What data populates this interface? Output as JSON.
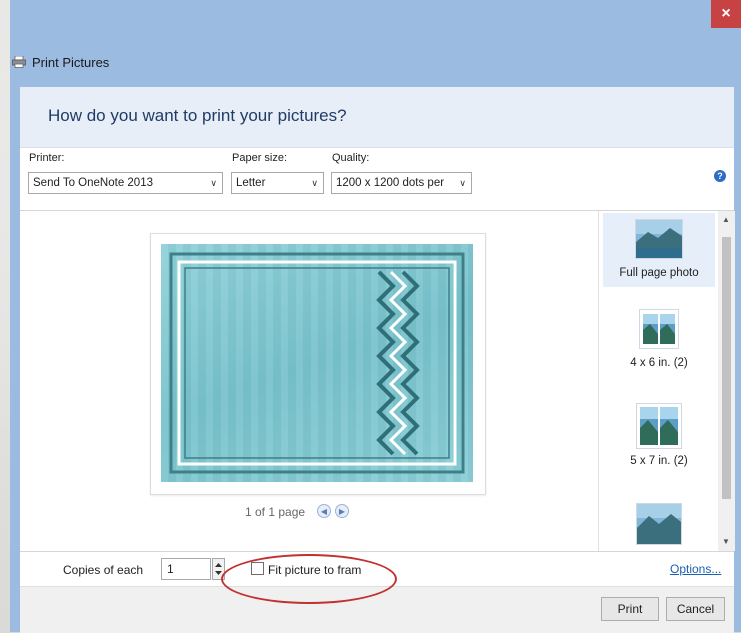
{
  "window": {
    "title": "Print Pictures",
    "close_icon": "×"
  },
  "heading": "How do you want to print your pictures?",
  "toolbar": {
    "printer_label": "Printer:",
    "printer_value": "Send To OneNote 2013",
    "paper_label": "Paper size:",
    "paper_value": "Letter",
    "quality_label": "Quality:",
    "quality_value": "1200 x 1200 dots per",
    "dropdown_arrow": "∨",
    "help_icon": "?"
  },
  "preview": {
    "page_info": "1 of 1 page",
    "prev_icon": "◀",
    "next_icon": "▶"
  },
  "layouts": [
    {
      "label": "Full page photo",
      "selected": true
    },
    {
      "label": "4 x 6 in. (2)",
      "selected": false
    },
    {
      "label": "5 x 7 in. (2)",
      "selected": false
    }
  ],
  "scroll": {
    "up": "▲",
    "down": "▼"
  },
  "bottom": {
    "copies_label": "Copies of each",
    "copies_value": "1",
    "fit_label": "Fit picture to fram",
    "fit_checked": false,
    "options_link": "Options..."
  },
  "buttons": {
    "print": "Print",
    "cancel": "Cancel"
  },
  "colors": {
    "chrome": "#9cbbe1",
    "heading_text": "#1f3b67",
    "close": "#c74343",
    "annotation": "#c23030",
    "photo": "#7cc5cf"
  }
}
